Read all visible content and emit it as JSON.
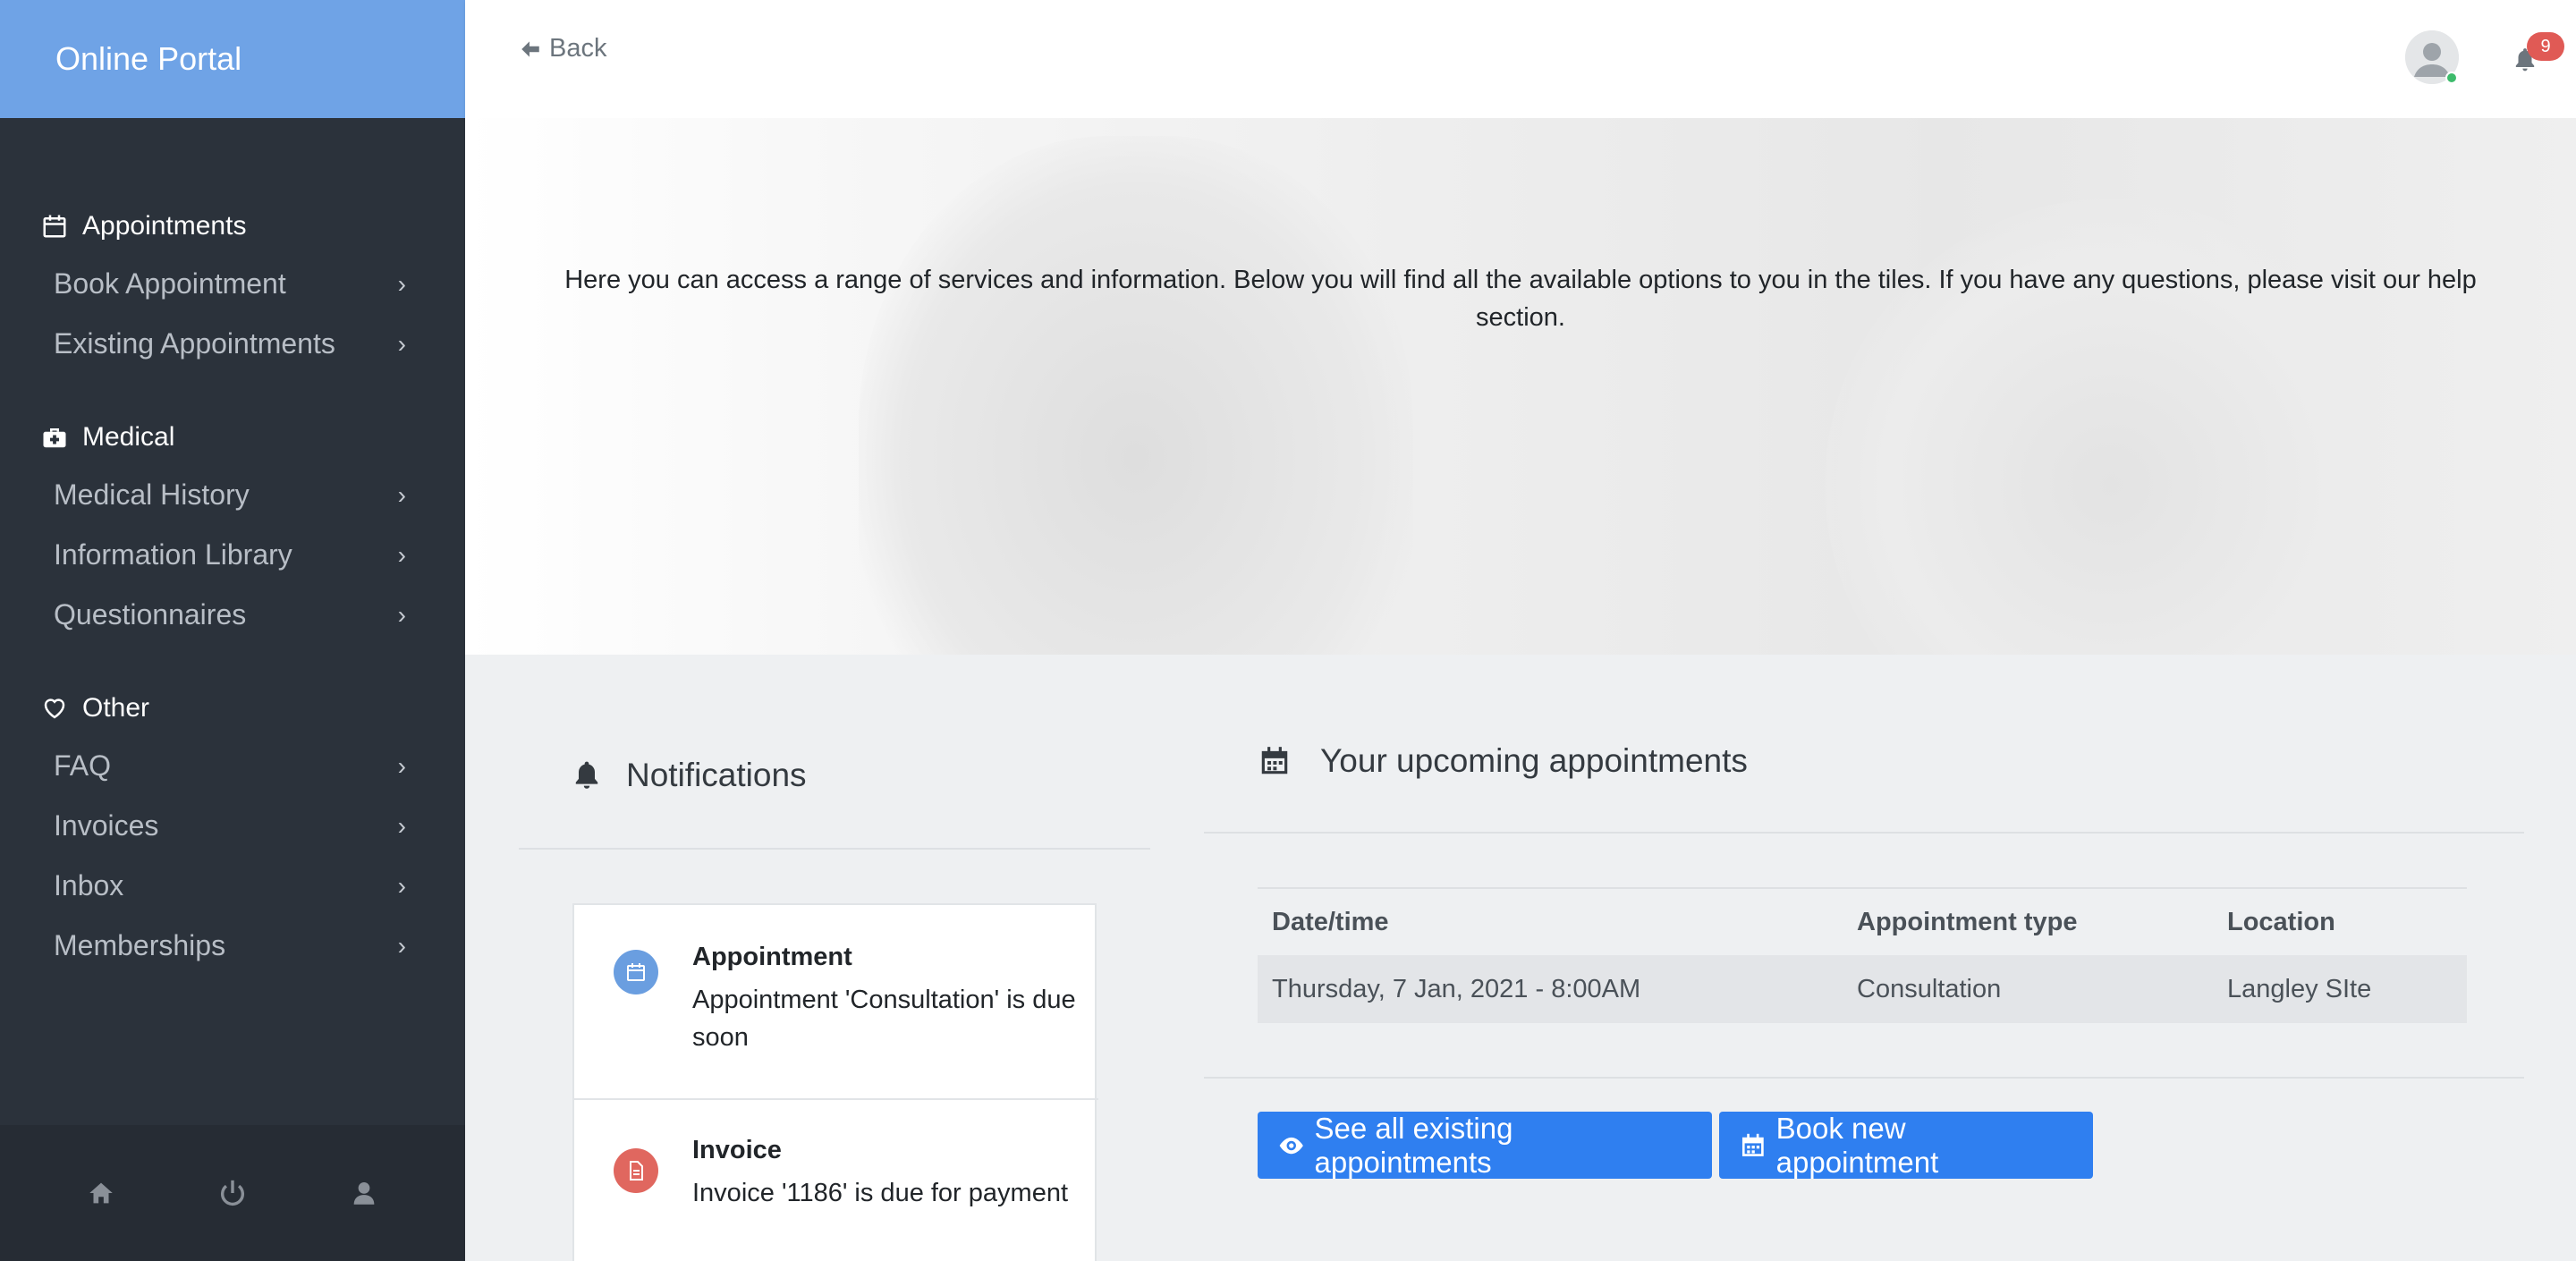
{
  "sidebar": {
    "brand": "Online Portal",
    "groups": [
      {
        "label": "Appointments",
        "icon": "calendar-icon",
        "items": [
          {
            "label": "Book Appointment"
          },
          {
            "label": "Existing Appointments"
          }
        ]
      },
      {
        "label": "Medical",
        "icon": "medical-kit-icon",
        "items": [
          {
            "label": "Medical History"
          },
          {
            "label": "Information Library"
          },
          {
            "label": "Questionnaires"
          }
        ]
      },
      {
        "label": "Other",
        "icon": "heart-icon",
        "items": [
          {
            "label": "FAQ"
          },
          {
            "label": "Invoices"
          },
          {
            "label": "Inbox"
          },
          {
            "label": "Memberships"
          }
        ]
      }
    ],
    "footer_icons": [
      "home-icon",
      "power-icon",
      "user-icon"
    ]
  },
  "topbar": {
    "back_label": "Back",
    "notification_count": "9"
  },
  "hero": {
    "text": "Here you can access a range of services and information. Below you will find all the available options to you in the tiles. If you have any questions, please visit our help section."
  },
  "notifications": {
    "title": "Notifications",
    "items": [
      {
        "title": "Appointment",
        "text": "Appointment 'Consultation' is due soon",
        "icon": "calendar-icon",
        "color": "#6a9ee0"
      },
      {
        "title": "Invoice",
        "text": "Invoice '1186' is due for payment",
        "icon": "document-icon",
        "color": "#e0675f"
      }
    ]
  },
  "appointments": {
    "title": "Your upcoming appointments",
    "columns": [
      "Date/time",
      "Appointment type",
      "Location"
    ],
    "rows": [
      {
        "datetime": "Thursday, 7 Jan, 2021 - 8:00AM",
        "type": "Consultation",
        "location": "Langley SIte"
      }
    ],
    "see_all_label": "See all existing appointments",
    "book_label": "Book new appointment"
  },
  "colors": {
    "brand": "#6fa3e6",
    "sidebar": "#2b323b",
    "button": "#2f7ff0"
  }
}
